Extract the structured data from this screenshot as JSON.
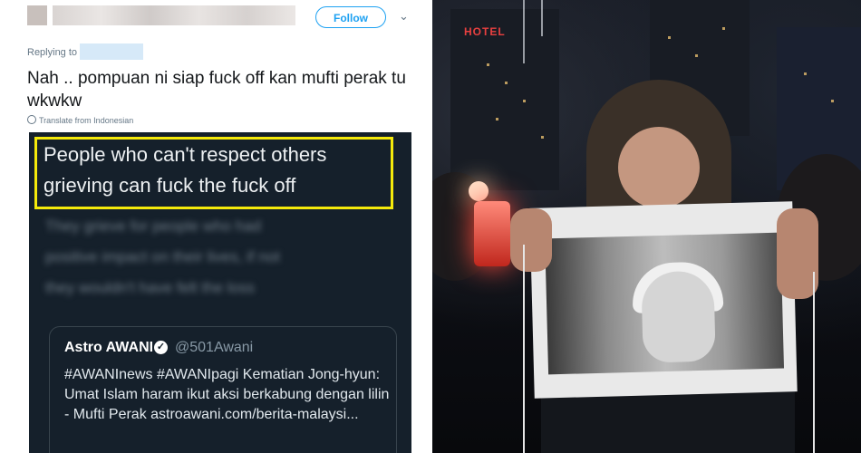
{
  "tweet": {
    "follow_label": "Follow",
    "reply_label": "Replying to",
    "text": "Nah .. pompuan ni siap fuck off kan mufti perak tu wkwkw",
    "translate": "Translate from Indonesian"
  },
  "card": {
    "highlight_line1": "People who can't respect others",
    "highlight_line2": "grieving can fuck the fuck off",
    "blur_line1": "They grieve for people who had",
    "blur_line2": "positive impact on their lives, if not",
    "blur_line3": "they wouldn't have felt the loss",
    "quote": {
      "name": "Astro AWANI",
      "handle": "@501Awani",
      "text": "#AWANInews #AWANIpagi Kematian Jong-hyun: Umat Islam haram ikut aksi berkabung dengan lilin - Mufti Perak astroawani.com/berita-malaysi..."
    }
  },
  "photo": {
    "sign_text": "HOTEL"
  },
  "colors": {
    "accent": "#1da1f2",
    "highlight": "#f5ea0b",
    "card_bg": "#15202b"
  }
}
